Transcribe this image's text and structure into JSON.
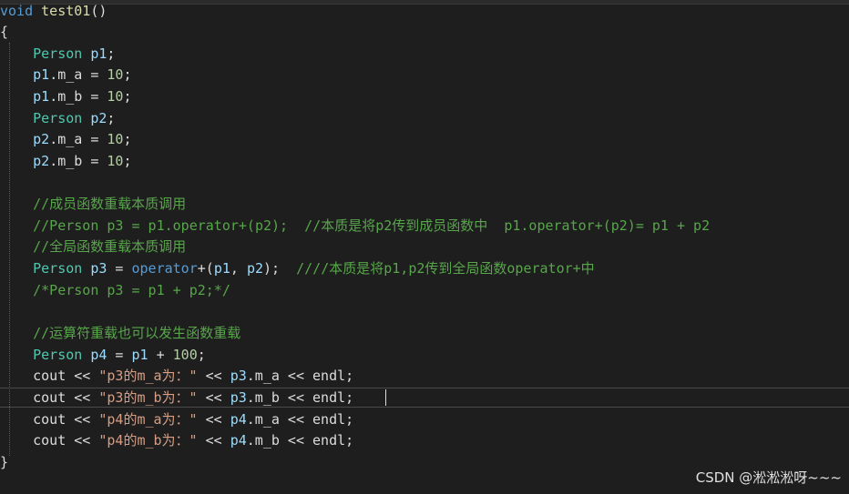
{
  "code": {
    "l1_kw": "void",
    "l1_fn": "test01",
    "l1_p": "()",
    "l2": "{",
    "l3_t": "Person",
    "l3_v": "p1",
    "l3_e": ";",
    "l4_v": "p1",
    "l4_m": ".m_a = ",
    "l4_n": "10",
    "l4_e": ";",
    "l5_v": "p1",
    "l5_m": ".m_b = ",
    "l5_n": "10",
    "l5_e": ";",
    "l6_t": "Person",
    "l6_v": "p2",
    "l6_e": ";",
    "l7_v": "p2",
    "l7_m": ".m_a = ",
    "l7_n": "10",
    "l7_e": ";",
    "l8_v": "p2",
    "l8_m": ".m_b = ",
    "l8_n": "10",
    "l8_e": ";",
    "l10_c": "//成员函数重载本质调用",
    "l11_c": "//Person p3 = p1.operator+(p2);  //本质是将p2传到成员函数中  p1.operator+(p2)= p1 + p2",
    "l12_c": "//全局函数重载本质调用",
    "l13_t": "Person",
    "l13_v": "p3",
    "l13_eq": " = ",
    "l13_fn": "operator",
    "l13_op": "+(",
    "l13_a1": "p1",
    "l13_cm": ", ",
    "l13_a2": "p2",
    "l13_end": ");  ",
    "l13_c": "////本质是将p1,p2传到全局函数operator+中",
    "l14_c": "/*Person p3 = p1 + p2;*/",
    "l16_c": "//运算符重载也可以发生函数重载",
    "l17_t": "Person",
    "l17_v": "p4",
    "l17_eq": " = ",
    "l17_a": "p1",
    "l17_plus": " + ",
    "l17_n": "100",
    "l17_e": ";",
    "l18_a": "cout << ",
    "l18_s": "\"p3的m_a为：\"",
    "l18_b": " << ",
    "l18_v": "p3",
    "l18_m": ".m_a << endl;",
    "l19_a": "cout << ",
    "l19_s": "\"p3的m_b为：\"",
    "l19_b": " << ",
    "l19_v": "p3",
    "l19_m": ".m_b << endl;",
    "l20_a": "cout << ",
    "l20_s": "\"p4的m_a为：\"",
    "l20_b": " << ",
    "l20_v": "p4",
    "l20_m": ".m_a << endl;",
    "l21_a": "cout << ",
    "l21_s": "\"p4的m_b为：\"",
    "l21_b": " << ",
    "l21_v": "p4",
    "l21_m": ".m_b << endl;",
    "l22": "}"
  },
  "watermark": "CSDN @淞淞淞呀~~~"
}
